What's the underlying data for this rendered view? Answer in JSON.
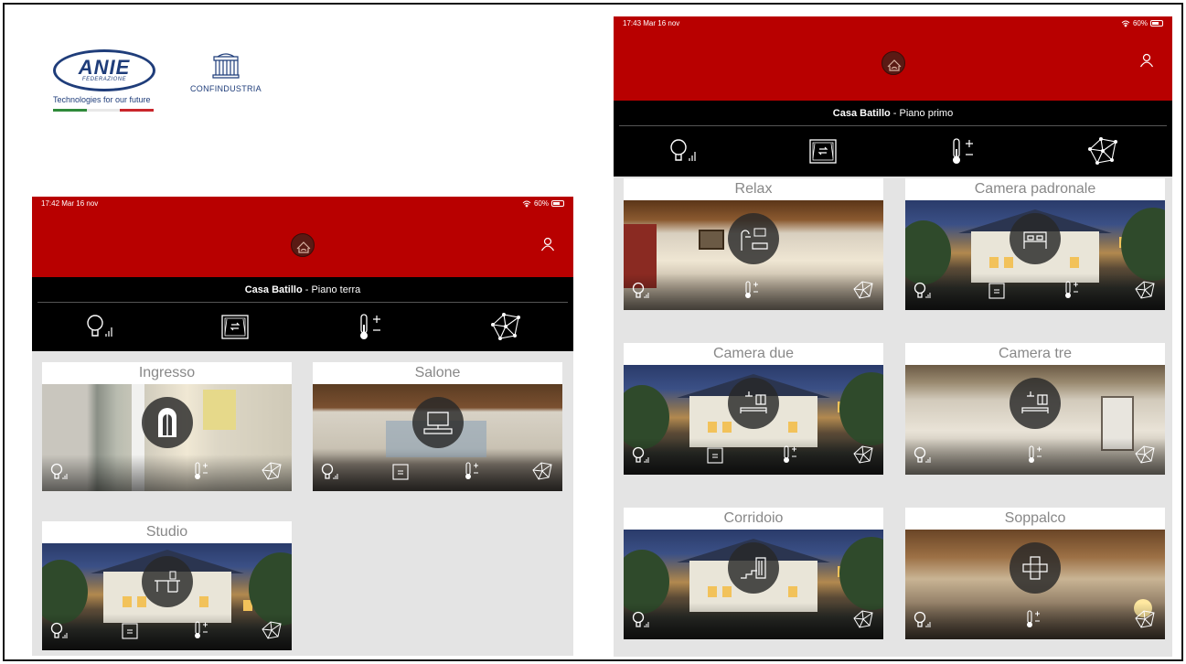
{
  "logos": {
    "anie": {
      "word": "ANIE",
      "sub": "FEDERAZIONE",
      "tagline": "Technologies for our future"
    },
    "confindustria": {
      "word": "CONFINDUSTRIA"
    }
  },
  "screen1": {
    "status": {
      "time": "17:42  Mar 16 nov",
      "battery": "60%"
    },
    "house_name": "Casa Batillo",
    "floor": " - Piano terra",
    "rooms": [
      {
        "title": "Ingresso",
        "icons": [
          "light",
          "therm",
          "net"
        ]
      },
      {
        "title": "Salone",
        "icons": [
          "light",
          "shutter",
          "therm",
          "net"
        ]
      },
      {
        "title": "Studio",
        "icons": [
          "light",
          "shutter",
          "therm",
          "net"
        ]
      }
    ]
  },
  "screen2": {
    "status": {
      "time": "17:43  Mar 16 nov",
      "battery": "60%"
    },
    "house_name": "Casa Batillo",
    "floor": " - Piano primo",
    "rooms": [
      {
        "title": "Relax"
      },
      {
        "title": "Camera padronale"
      },
      {
        "title": "Camera due"
      },
      {
        "title": "Camera tre"
      },
      {
        "title": "Corridoio"
      },
      {
        "title": "Soppalco"
      }
    ]
  },
  "colors": {
    "header_red": "#b80000",
    "nav_black": "#000000",
    "background_grey": "#e4e4e4"
  }
}
